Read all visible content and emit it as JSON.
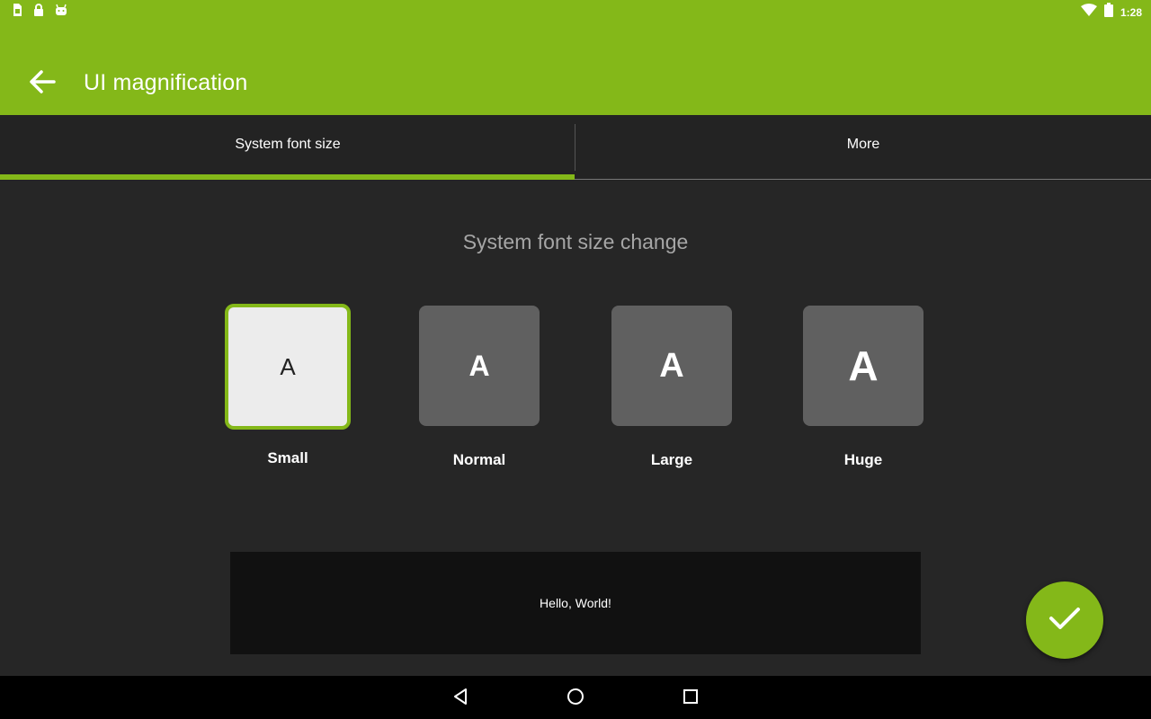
{
  "status_bar": {
    "time": "1:28",
    "left_icons": [
      "sim-icon",
      "lock-icon",
      "android-icon"
    ],
    "right_icons": [
      "wifi-icon",
      "battery-icon"
    ]
  },
  "toolbar": {
    "title": "UI magnification",
    "back_icon": "back-arrow-icon"
  },
  "tabs": [
    {
      "label": "System font size",
      "selected": true
    },
    {
      "label": "More",
      "selected": false
    }
  ],
  "main": {
    "section_title": "System font size change",
    "sample_glyph": "A",
    "options": [
      {
        "label": "Small",
        "selected": true
      },
      {
        "label": "Normal",
        "selected": false
      },
      {
        "label": "Large",
        "selected": false
      },
      {
        "label": "Huge",
        "selected": false
      }
    ],
    "preview_text": "Hello, World!"
  },
  "fab": {
    "icon": "check-icon"
  },
  "nav_bar": {
    "icons": [
      "back-triangle-icon",
      "home-circle-icon",
      "recents-square-icon"
    ]
  },
  "colors": {
    "accent": "#84b819",
    "background": "#262626",
    "tab_bar": "#232323",
    "option_tile": "#606060",
    "selected_tile": "#ececec",
    "preview_bg": "#111111"
  }
}
